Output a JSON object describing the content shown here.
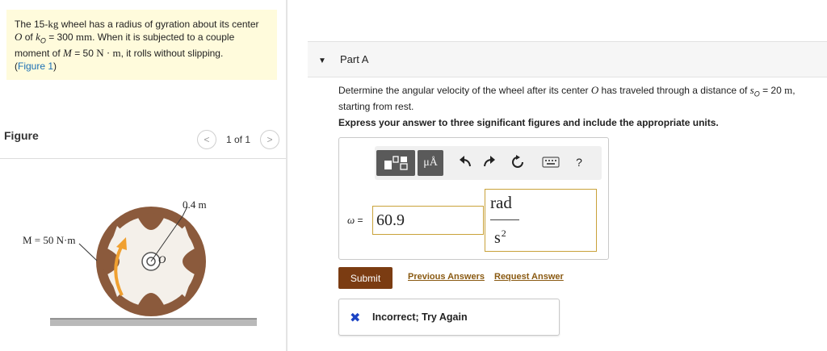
{
  "problem": {
    "line1_pre": "The 15-",
    "line1_kg": "kg",
    "line1_post": " wheel has a radius of gyration about its center",
    "line2_O": "O",
    "line2_of": " of ",
    "line2_k": "k",
    "line2_ksub": "O",
    "line2_eq": " = 300 ",
    "line2_mm": "mm",
    "line2_post": ". When it is subjected to a couple",
    "line3_pre": "moment of ",
    "line3_M": "M",
    "line3_eq": " = 50 ",
    "line3_unit": "N · m",
    "line3_post": ", it rolls without slipping.",
    "figure_link_open": "(",
    "figure_link": "Figure 1",
    "figure_link_close": ")"
  },
  "figure": {
    "title": "Figure",
    "prev_glyph": "<",
    "next_glyph": ">",
    "page_indicator": "1 of 1",
    "label_radius": "0.4 m",
    "label_moment": "M = 50 N·m",
    "label_center": "O"
  },
  "part": {
    "caret": "▼",
    "label": "Part A"
  },
  "question": {
    "text_pre": "Determine the angular velocity of the wheel after its center ",
    "text_O": "O",
    "text_mid": " has traveled through a distance of ",
    "text_s": "s",
    "text_ssub": "O",
    "text_eq": " = 20 ",
    "text_unit": "m",
    "text_post": ",",
    "line2": "starting from rest.",
    "instruction": "Express your answer to three significant figures and include the appropriate units."
  },
  "answer": {
    "toolbar": {
      "units_glyph": "μÅ",
      "undo_glyph": "↶",
      "redo_glyph": "↷",
      "reset_glyph": "↻",
      "help_glyph": "?"
    },
    "variable": "ω",
    "equals": " =",
    "value": "60.9",
    "unit_numerator": "rad",
    "unit_denominator": "s",
    "unit_exponent": "2"
  },
  "actions": {
    "submit": "Submit",
    "previous_answers": "Previous Answers",
    "request_answer": "Request Answer"
  },
  "feedback": {
    "icon": "✖",
    "text": "Incorrect; Try Again"
  },
  "colors": {
    "problem_bg": "#fffbdc",
    "submit_bg": "#7b3c12",
    "link": "#8a5a12",
    "feedback_icon": "#1b43c4",
    "input_border": "#c9a23a",
    "wheel_rim": "#8b5a3c",
    "moment_arrow": "#f0a030"
  }
}
